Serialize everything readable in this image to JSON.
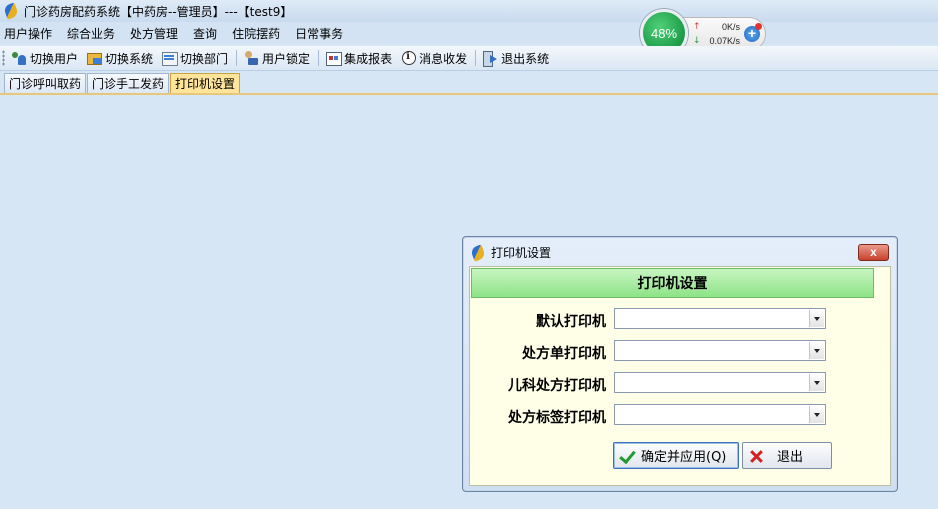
{
  "window": {
    "title": "门诊药房配药系统【中药房--管理员】---【test9】"
  },
  "menu": {
    "items": [
      "用户操作",
      "综合业务",
      "处方管理",
      "查询",
      "住院摆药",
      "日常事务"
    ]
  },
  "toolbar": {
    "switch_user": "切换用户",
    "switch_system": "切换系统",
    "switch_dept": "切换部门",
    "lock_user": "用户锁定",
    "reports": "集成报表",
    "messages": "消息收发",
    "exit_system": "退出系统"
  },
  "tabs": [
    {
      "label": "门诊呼叫取药",
      "active": false
    },
    {
      "label": "门诊手工发药",
      "active": false
    },
    {
      "label": "打印机设置",
      "active": true
    }
  ],
  "net_monitor": {
    "percent": "48%",
    "upload": "0K/s",
    "download": "0.07K/s"
  },
  "dialog": {
    "title": "打印机设置",
    "header": "打印机设置",
    "fields": [
      {
        "label": "默认打印机",
        "value": ""
      },
      {
        "label": "处方单打印机",
        "value": ""
      },
      {
        "label": "儿科处方打印机",
        "value": ""
      },
      {
        "label": "处方标签打印机",
        "value": ""
      }
    ],
    "confirm_label": "确定并应用(Q)",
    "exit_label": "退出",
    "close_glyph": "x"
  },
  "colors": {
    "background": "#d6e6f4",
    "dialog_body": "#ffffe8",
    "header_green": "#8de387",
    "active_tab": "#ffe49a",
    "net_green": "#1c9a48"
  }
}
